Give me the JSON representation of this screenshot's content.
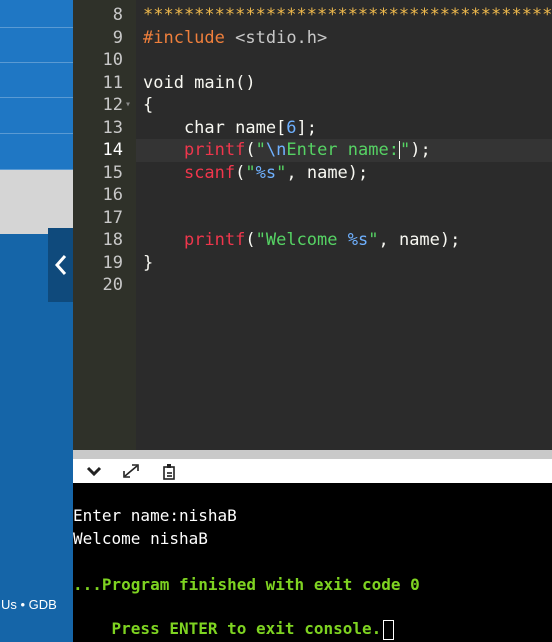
{
  "sidebar": {
    "footer_text": "Us • GDB"
  },
  "editor": {
    "lines": [
      {
        "num": "8",
        "parts": [
          {
            "cls": "cm",
            "text": "****************************************"
          }
        ]
      },
      {
        "num": "9",
        "parts": [
          {
            "cls": "pp",
            "text": "#include"
          },
          {
            "cls": "cx",
            "text": " "
          },
          {
            "cls": "inc",
            "text": "<stdio.h>"
          }
        ]
      },
      {
        "num": "10",
        "parts": []
      },
      {
        "num": "11",
        "parts": [
          {
            "cls": "cx",
            "text": "void main()"
          }
        ]
      },
      {
        "num": "12",
        "fold": "▾",
        "parts": [
          {
            "cls": "cx",
            "text": "{"
          }
        ]
      },
      {
        "num": "13",
        "parts": [
          {
            "cls": "cx",
            "text": "    char name["
          },
          {
            "cls": "nm",
            "text": "6"
          },
          {
            "cls": "cx",
            "text": "];"
          }
        ]
      },
      {
        "num": "14",
        "active": true,
        "parts": [
          {
            "cls": "cx",
            "text": "    "
          },
          {
            "cls": "fn",
            "text": "printf"
          },
          {
            "cls": "cx",
            "text": "("
          },
          {
            "cls": "st",
            "text": "\""
          },
          {
            "cls": "es",
            "text": "\\n"
          },
          {
            "cls": "st",
            "text": "Enter name:"
          },
          {
            "cls": "caret",
            "text": ""
          },
          {
            "cls": "st",
            "text": "\""
          },
          {
            "cls": "cx",
            "text": ");"
          }
        ]
      },
      {
        "num": "15",
        "parts": [
          {
            "cls": "cx",
            "text": "    "
          },
          {
            "cls": "fn",
            "text": "scanf"
          },
          {
            "cls": "cx",
            "text": "("
          },
          {
            "cls": "st",
            "text": "\""
          },
          {
            "cls": "es",
            "text": "%s"
          },
          {
            "cls": "st",
            "text": "\""
          },
          {
            "cls": "cx",
            "text": ", name);"
          }
        ]
      },
      {
        "num": "16",
        "parts": []
      },
      {
        "num": "17",
        "parts": []
      },
      {
        "num": "18",
        "parts": [
          {
            "cls": "cx",
            "text": "    "
          },
          {
            "cls": "fn",
            "text": "printf"
          },
          {
            "cls": "cx",
            "text": "("
          },
          {
            "cls": "st",
            "text": "\"Welcome "
          },
          {
            "cls": "es",
            "text": "%s"
          },
          {
            "cls": "st",
            "text": "\""
          },
          {
            "cls": "cx",
            "text": ", name);"
          }
        ]
      },
      {
        "num": "19",
        "parts": [
          {
            "cls": "cx",
            "text": "}"
          }
        ]
      },
      {
        "num": "20",
        "parts": []
      }
    ]
  },
  "console": {
    "line1": "Enter name:nishaB",
    "line2": "Welcome nishaB",
    "line3": "...Program finished with exit code 0",
    "line4": "Press ENTER to exit console."
  },
  "icons": {
    "collapse": "chevron-left-icon",
    "minimize": "chevron-down-icon",
    "expand": "expand-icon",
    "copy": "copy-icon"
  },
  "colors": {
    "sidebar": "#1565a8",
    "editor_bg": "#2b2b2b",
    "keyword_red": "#f0364c",
    "string_green": "#56d364",
    "console_green": "#7ed321"
  }
}
